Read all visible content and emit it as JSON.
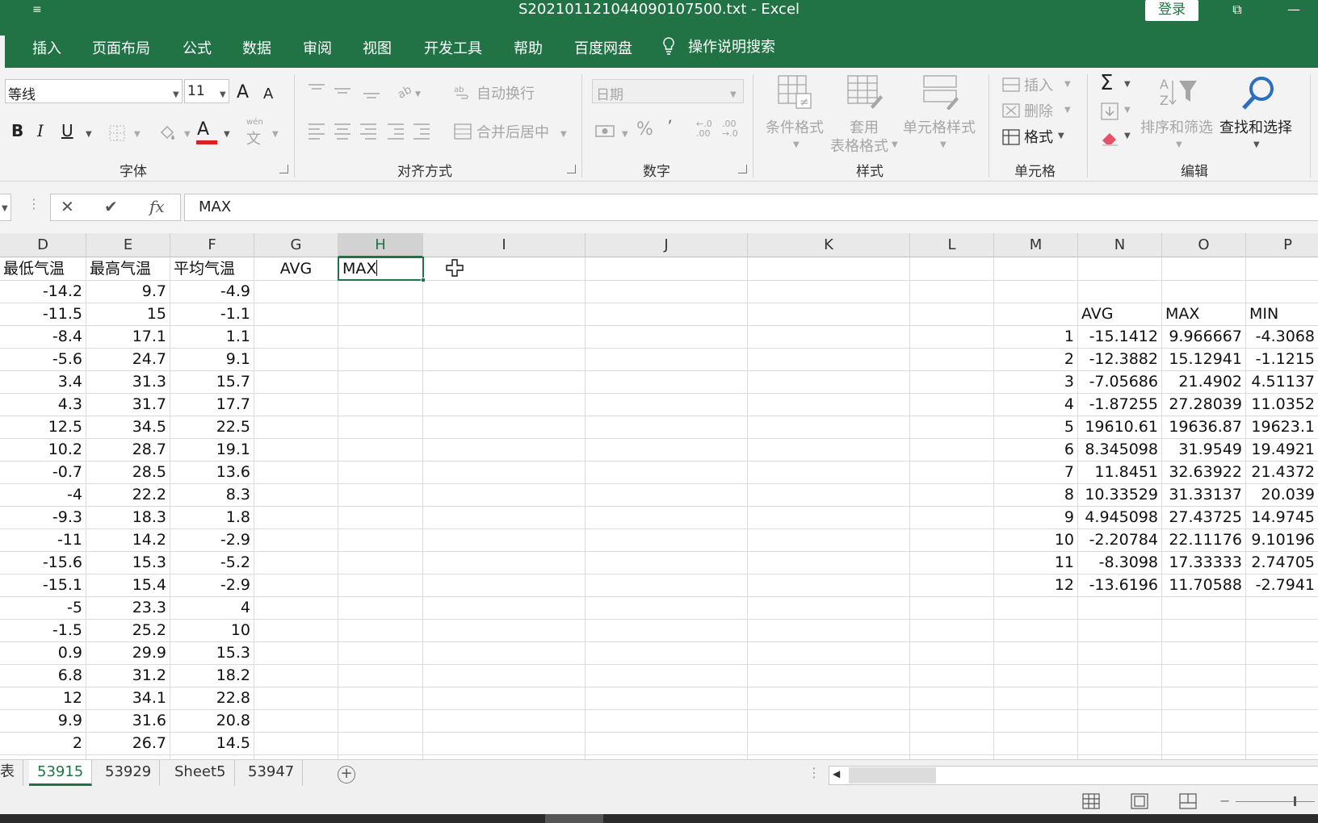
{
  "window": {
    "title": "S202101121044090107500.txt  -  Excel",
    "login_label": "登录",
    "qat_symbol": "≡",
    "restore_symbol": "⧉",
    "minimize_symbol": "—"
  },
  "ribbon_tabs": [
    {
      "label": "插入"
    },
    {
      "label": "页面布局"
    },
    {
      "label": "公式"
    },
    {
      "label": "数据"
    },
    {
      "label": "审阅"
    },
    {
      "label": "视图"
    },
    {
      "label": "开发工具"
    },
    {
      "label": "帮助"
    },
    {
      "label": "百度网盘"
    }
  ],
  "tell_me": "操作说明搜索",
  "font_group": {
    "label": "字体",
    "font_name": "等线",
    "font_size": "11",
    "grow": "A",
    "shrink": "A",
    "bold": "B",
    "italic": "I",
    "underline": "U",
    "font_color_letter": "A",
    "font_color": "#e0201b",
    "phonetic_top": "wén",
    "phonetic_bottom": "文"
  },
  "align_group": {
    "label": "对齐方式",
    "wrap_text": "自动换行",
    "merge_center": "合并后居中"
  },
  "number_group": {
    "label": "数字",
    "format": "日期",
    "percent": "%",
    "comma": "’",
    "inc_decimal": "←.0\n.00",
    "dec_decimal": ".00\n→.0"
  },
  "styles_group": {
    "label": "样式",
    "conditional": "条件格式",
    "table_line1": "套用",
    "table_line2": "表格格式",
    "cell_styles": "单元格样式"
  },
  "cells_group": {
    "label": "单元格",
    "insert": "插入",
    "delete": "删除",
    "format": "格式"
  },
  "editing_group": {
    "label": "编辑",
    "sigma": "Σ",
    "sort_filter": "排序和筛选",
    "find_select": "查找和选择"
  },
  "formula_bar": {
    "cancel": "✕",
    "enter": "✔",
    "fx": "fx",
    "value": "MAX"
  },
  "columns": [
    {
      "label": "D"
    },
    {
      "label": "E"
    },
    {
      "label": "F"
    },
    {
      "label": "G"
    },
    {
      "label": "H"
    },
    {
      "label": "I"
    },
    {
      "label": "J"
    },
    {
      "label": "K"
    },
    {
      "label": "L"
    },
    {
      "label": "M"
    },
    {
      "label": "N"
    },
    {
      "label": "O"
    },
    {
      "label": "P"
    }
  ],
  "header_row": {
    "d": "最低气温",
    "e": "最高气温",
    "f": "平均气温",
    "g": "AVG",
    "h": "MAX"
  },
  "left_rows": [
    {
      "d": "-14.2",
      "e": "9.7",
      "f": "-4.9"
    },
    {
      "d": "-11.5",
      "e": "15",
      "f": "-1.1"
    },
    {
      "d": "-8.4",
      "e": "17.1",
      "f": "1.1"
    },
    {
      "d": "-5.6",
      "e": "24.7",
      "f": "9.1"
    },
    {
      "d": "3.4",
      "e": "31.3",
      "f": "15.7"
    },
    {
      "d": "4.3",
      "e": "31.7",
      "f": "17.7"
    },
    {
      "d": "12.5",
      "e": "34.5",
      "f": "22.5"
    },
    {
      "d": "10.2",
      "e": "28.7",
      "f": "19.1"
    },
    {
      "d": "-0.7",
      "e": "28.5",
      "f": "13.6"
    },
    {
      "d": "-4",
      "e": "22.2",
      "f": "8.3"
    },
    {
      "d": "-9.3",
      "e": "18.3",
      "f": "1.8"
    },
    {
      "d": "-11",
      "e": "14.2",
      "f": "-2.9"
    },
    {
      "d": "-15.6",
      "e": "15.3",
      "f": "-5.2"
    },
    {
      "d": "-15.1",
      "e": "15.4",
      "f": "-2.9"
    },
    {
      "d": "-5",
      "e": "23.3",
      "f": "4"
    },
    {
      "d": "-1.5",
      "e": "25.2",
      "f": "10"
    },
    {
      "d": "0.9",
      "e": "29.9",
      "f": "15.3"
    },
    {
      "d": "6.8",
      "e": "31.2",
      "f": "18.2"
    },
    {
      "d": "12",
      "e": "34.1",
      "f": "22.8"
    },
    {
      "d": "9.9",
      "e": "31.6",
      "f": "20.8"
    },
    {
      "d": "2",
      "e": "26.7",
      "f": "14.5"
    }
  ],
  "summary_header": {
    "n": "AVG",
    "o": "MAX",
    "p": "MIN"
  },
  "summary_rows": [
    {
      "m": "1",
      "n": "-15.1412",
      "o": "9.966667",
      "p": "-4.3068"
    },
    {
      "m": "2",
      "n": "-12.3882",
      "o": "15.12941",
      "p": "-1.1215"
    },
    {
      "m": "3",
      "n": "-7.05686",
      "o": "21.4902",
      "p": "4.51137"
    },
    {
      "m": "4",
      "n": "-1.87255",
      "o": "27.28039",
      "p": "11.0352"
    },
    {
      "m": "5",
      "n": "19610.61",
      "o": "19636.87",
      "p": "19623.1"
    },
    {
      "m": "6",
      "n": "8.345098",
      "o": "31.9549",
      "p": "19.4921"
    },
    {
      "m": "7",
      "n": "11.8451",
      "o": "32.63922",
      "p": "21.4372"
    },
    {
      "m": "8",
      "n": "10.33529",
      "o": "31.33137",
      "p": "20.039"
    },
    {
      "m": "9",
      "n": "4.945098",
      "o": "27.43725",
      "p": "14.9745"
    },
    {
      "m": "10",
      "n": "-2.20784",
      "o": "22.11176",
      "p": "9.10196"
    },
    {
      "m": "11",
      "n": "-8.3098",
      "o": "17.33333",
      "p": "2.74705"
    },
    {
      "m": "12",
      "n": "-13.6196",
      "o": "11.70588",
      "p": "-2.7941"
    }
  ],
  "sheet_tabs": [
    {
      "label": "表"
    },
    {
      "label": "53915",
      "active": true
    },
    {
      "label": "53929"
    },
    {
      "label": "Sheet5"
    },
    {
      "label": "53947"
    }
  ],
  "add_sheet": "+",
  "colors": {
    "accent": "#217346",
    "ribbon_bg": "#f3f3f3"
  }
}
